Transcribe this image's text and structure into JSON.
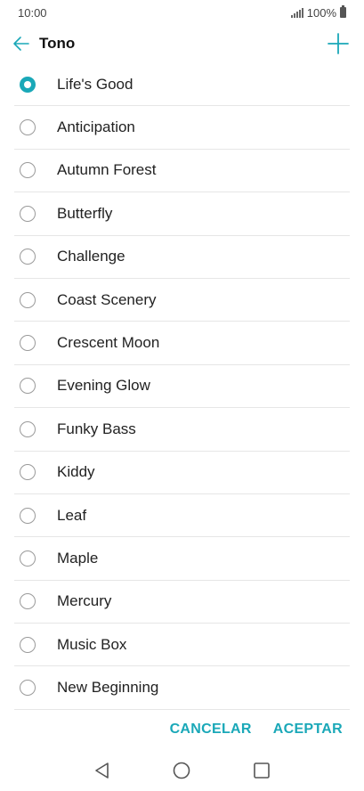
{
  "status_bar": {
    "time": "10:00",
    "battery": "100%"
  },
  "header": {
    "title": "Tono"
  },
  "ringtones": [
    {
      "label": "Life's Good",
      "selected": true
    },
    {
      "label": "Anticipation",
      "selected": false
    },
    {
      "label": "Autumn Forest",
      "selected": false
    },
    {
      "label": "Butterfly",
      "selected": false
    },
    {
      "label": "Challenge",
      "selected": false
    },
    {
      "label": "Coast Scenery",
      "selected": false
    },
    {
      "label": "Crescent Moon",
      "selected": false
    },
    {
      "label": "Evening Glow",
      "selected": false
    },
    {
      "label": "Funky Bass",
      "selected": false
    },
    {
      "label": "Kiddy",
      "selected": false
    },
    {
      "label": "Leaf",
      "selected": false
    },
    {
      "label": "Maple",
      "selected": false
    },
    {
      "label": "Mercury",
      "selected": false
    },
    {
      "label": "Music Box",
      "selected": false
    },
    {
      "label": "New Beginning",
      "selected": false
    }
  ],
  "actions": {
    "cancel": "CANCELAR",
    "accept": "ACEPTAR"
  },
  "colors": {
    "accent": "#1aa8b8"
  },
  "icons": {
    "back": "arrow-left-icon",
    "add": "plus-icon",
    "nav_back": "triangle-back-icon",
    "nav_home": "circle-home-icon",
    "nav_recent": "square-recent-icon"
  }
}
